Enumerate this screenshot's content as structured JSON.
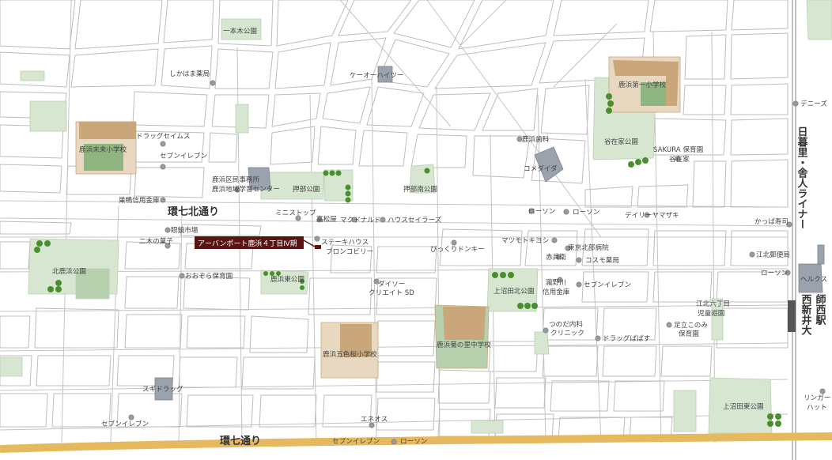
{
  "colors": {
    "road_stroke": "#bfbfbf",
    "park_fill": "#d7e6d1",
    "school_fill": "#c9a77a",
    "building_fill": "#9aa2ad",
    "tree": "#4a8f2e",
    "major_road": "#e7b95e",
    "callout_bg": "#5a1313",
    "station_block": "#555555"
  },
  "roads": {
    "kanana_north": "環七北通り",
    "kanana": "環七通り",
    "nippori_liner": "日暮里・舎人ライナー"
  },
  "station": {
    "name": "西新井大師西駅"
  },
  "property_callout": "アーバンポート鹿浜４丁目Ⅳ期",
  "labels": {
    "ipponki_park": "一本木公園",
    "shikahama_pharmacy": "しかはま薬局",
    "keio_heights": "ケーオーハイツー",
    "dennys": "デニーズ",
    "shikahama_dai1_es": "鹿浜第一小学校",
    "drug_seims": "ドラッグセイムス",
    "seven_eleven_1": "セブンイレブン",
    "shikahama_mirai_school": "鹿浜未来小学校",
    "shikahama_dental": "鹿浜歯科",
    "yazaike_park": "谷在家公園",
    "sakura_nursery": "SAKURA 保育園",
    "yazaike": "谷在家",
    "komeda": "コメダイダ",
    "office": "鹿浜区民事務所",
    "community_center": "鹿浜地域学習センター",
    "oshibe_park": "押部公園",
    "oshibe_minami_park": "押部南公園",
    "sugamo_shinkin": "巣鴨信用金庫",
    "lawson_1": "ローソン",
    "lawson_2": "ローソン",
    "daily_yamazaki": "デイリーヤマザキ",
    "kappa_sushi": "かっぱ寿司",
    "ministop": "ミニストップ",
    "takamatsuya": "高松屋",
    "mcdonalds": "マクドナルド",
    "house_sailors": "ハウスセイラーズ",
    "ganshou": "眼鏡市場",
    "steak_house": "ステーキハウス",
    "bronco_billy": "ブロンコビリー",
    "nikino_kashi": "二木の菓子",
    "bikkuri_donki": "びっくりドンキー",
    "matsumoto_kiyoshi": "マツモトキヨシ",
    "tokyo_north_hospital": "東京北部病院",
    "akahyoe": "赤兵衛",
    "cosmos": "コスモ薬局",
    "kohoku_post": "江北郵便局",
    "lawson_3": "ローソン",
    "herkus": "ヘルクス",
    "kitashikahama_park": "北鹿浜公園",
    "ozora_nursery": "おおぞら保育園",
    "shikahama_higashi_park": "鹿浜東公園",
    "daiso_1": "ダイソー",
    "daiso_2": "クリエイト SD",
    "kamiNumata_kita_park": "上沼田北公園",
    "takinogawa_1": "瀧野川",
    "takinogawa_2": "信用金庫",
    "seven_eleven_2": "セブンイレブン",
    "kohoku_6_1": "江北六丁目",
    "kohoku_6_2": "児童遊園",
    "tsunoda_1": "つのだ内科",
    "tsunoda_2": "クリニック",
    "drug_papas": "ドラッグぱぱす",
    "adachi_komichi_1": "足立このみ",
    "adachi_komichi_2": "保育園",
    "shikahama_goshiki": "鹿浜五色桜小学校",
    "shikahama_kiku": "鹿浜菊の里中学校",
    "suguri_drug": "スギドラッグ",
    "seven_eleven_3": "セブンイレブン",
    "eneos": "エネオス",
    "seven_eleven_4": "セブンイレブン",
    "lawson_4": "ローソン",
    "kamiNumata_higashi_park": "上沼田東公園",
    "ringer_hut_1": "リンガー",
    "ringer_hut_2": "ハット"
  }
}
